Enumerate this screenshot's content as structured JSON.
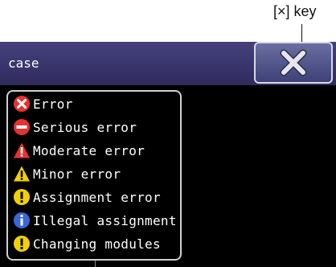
{
  "callout": {
    "label": "[×] key"
  },
  "title_bar": {
    "title": "case"
  },
  "close_button": {
    "icon": "close-x-icon"
  },
  "legend": [
    {
      "label": "Error",
      "icon": "error-x-icon",
      "color": "#e8322f"
    },
    {
      "label": "Serious error",
      "icon": "serious-error-minus-icon",
      "color": "#e8322f"
    },
    {
      "label": "Moderate error",
      "icon": "moderate-error-triangle-icon",
      "color": "#e8322f"
    },
    {
      "label": "Minor error",
      "icon": "minor-error-triangle-icon",
      "color": "#f2d000"
    },
    {
      "label": "Assignment error",
      "icon": "assignment-error-exclamation-icon",
      "color": "#f2d000"
    },
    {
      "label": "Illegal assignment",
      "icon": "illegal-assignment-info-icon",
      "color": "#3a66d6"
    },
    {
      "label": "Changing modules",
      "icon": "changing-modules-exclamation-icon",
      "color": "#f2d000"
    }
  ]
}
